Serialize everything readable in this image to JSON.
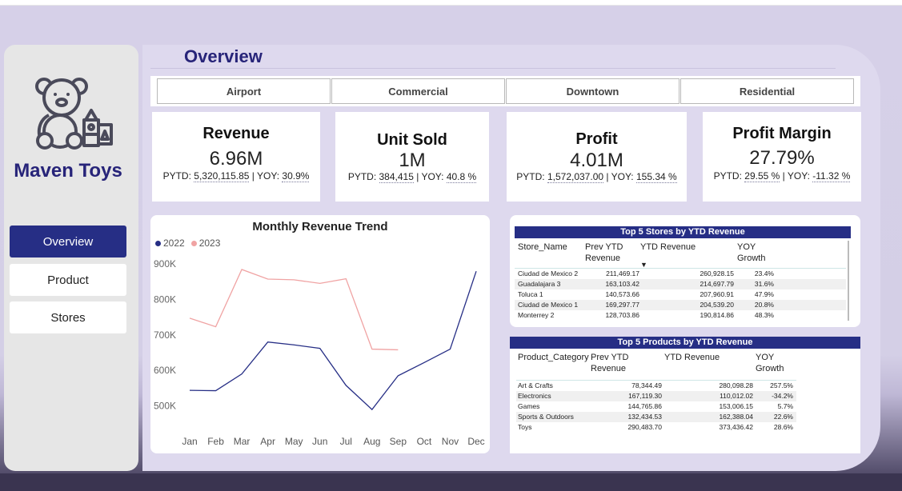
{
  "brand": {
    "name": "Maven Toys"
  },
  "page": {
    "title": "Overview"
  },
  "nav": {
    "items": [
      {
        "label": "Overview"
      },
      {
        "label": "Product"
      },
      {
        "label": "Stores"
      }
    ]
  },
  "slicer": {
    "options": [
      "Airport",
      "Commercial",
      "Downtown",
      "Residential"
    ]
  },
  "kpis": {
    "revenue": {
      "title": "Revenue",
      "value": "6.96M",
      "pytd_label": "PYTD:",
      "pytd": "5,320,115.85",
      "yoy_label": "YOY:",
      "yoy": "30.9%"
    },
    "units": {
      "title": "Unit Sold",
      "value": "1M",
      "pytd_label": "PYTD:",
      "pytd": "384,415",
      "yoy_label": "YOY:",
      "yoy": "40.8 %"
    },
    "profit": {
      "title": "Profit",
      "value": "4.01M",
      "pytd_label": "PYTD:",
      "pytd": "1,572,037.00",
      "yoy_label": "YOY:",
      "yoy": "155.34 %"
    },
    "margin": {
      "title": "Profit Margin",
      "value": "27.79%",
      "pytd_label": "PYTD:",
      "pytd": "29.55 %",
      "yoy_label": "YOY:",
      "yoy": "-11.32 %"
    }
  },
  "chart_data": {
    "type": "line",
    "title": "Monthly Revenue Trend",
    "categories": [
      "Jan",
      "Feb",
      "Mar",
      "Apr",
      "May",
      "Jun",
      "Jul",
      "Aug",
      "Sep",
      "Oct",
      "Nov",
      "Dec"
    ],
    "y_ticks": [
      "900K",
      "800K",
      "700K",
      "600K",
      "500K"
    ],
    "ylim": [
      470000,
      920000
    ],
    "legend_position": "top-left",
    "grid": false,
    "series": [
      {
        "name": "2022",
        "color": "#262e85",
        "values": [
          544000,
          543000,
          590000,
          680000,
          672000,
          662000,
          558000,
          490000,
          585000,
          622000,
          660000,
          879000
        ]
      },
      {
        "name": "2023",
        "color": "#f0a3a3",
        "values": [
          747000,
          723000,
          884000,
          857000,
          855000,
          845000,
          858000,
          660000,
          658000
        ]
      }
    ]
  },
  "stores_table": {
    "title": "Top 5 Stores by YTD Revenue",
    "columns": [
      "Store_Name",
      "Prev YTD Revenue",
      "YTD Revenue",
      "YOY Growth"
    ],
    "sort_indicator": "▼",
    "rows": [
      [
        "Ciudad de Mexico 2",
        "211,469.17",
        "260,928.15",
        "23.4%"
      ],
      [
        "Guadalajara 3",
        "163,103.42",
        "214,697.79",
        "31.6%"
      ],
      [
        "Toluca 1",
        "140,573.66",
        "207,960.91",
        "47.9%"
      ],
      [
        "Ciudad de Mexico 1",
        "169,297.77",
        "204,539.20",
        "20.8%"
      ],
      [
        "Monterrey 2",
        "128,703.86",
        "190,814.86",
        "48.3%"
      ]
    ]
  },
  "products_table": {
    "title": "Top 5 Products by YTD Revenue",
    "columns": [
      "Product_Category",
      "Prev YTD Revenue",
      "YTD Revenue",
      "YOY Growth"
    ],
    "rows": [
      [
        "Art & Crafts",
        "78,344.49",
        "280,098.28",
        "257.5%"
      ],
      [
        "Electronics",
        "167,119.30",
        "110,012.02",
        "-34.2%"
      ],
      [
        "Games",
        "144,765.86",
        "153,006.15",
        "5.7%"
      ],
      [
        "Sports & Outdoors",
        "132,434.53",
        "162,388.04",
        "22.6%"
      ],
      [
        "Toys",
        "290,483.70",
        "373,436.42",
        "28.6%"
      ]
    ]
  }
}
